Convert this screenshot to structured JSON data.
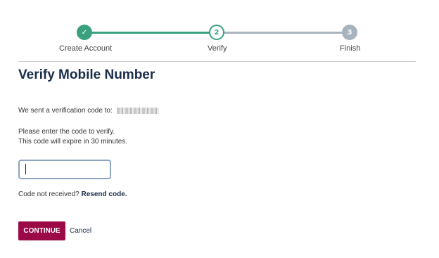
{
  "stepper": {
    "steps": [
      {
        "label": "Create Account",
        "indicator": "✓",
        "state": "complete"
      },
      {
        "label": "Verify",
        "indicator": "2",
        "state": "current"
      },
      {
        "label": "Finish",
        "indicator": "3",
        "state": "upcoming"
      }
    ],
    "colors": {
      "complete": "#3aa17e",
      "upcoming": "#a9b3bd"
    }
  },
  "page": {
    "title": "Verify Mobile Number",
    "sent_text": "We sent a verification code to:",
    "instruction_line1": "Please enter the code to verify.",
    "instruction_line2": "This code will expire in 30 minutes.",
    "code_input": {
      "value": "",
      "placeholder": ""
    },
    "not_received_text": "Code not received?",
    "resend_label": "Resend code."
  },
  "actions": {
    "continue_label": "CONTINUE",
    "cancel_label": "Cancel",
    "primary_color": "#9b0a47"
  }
}
